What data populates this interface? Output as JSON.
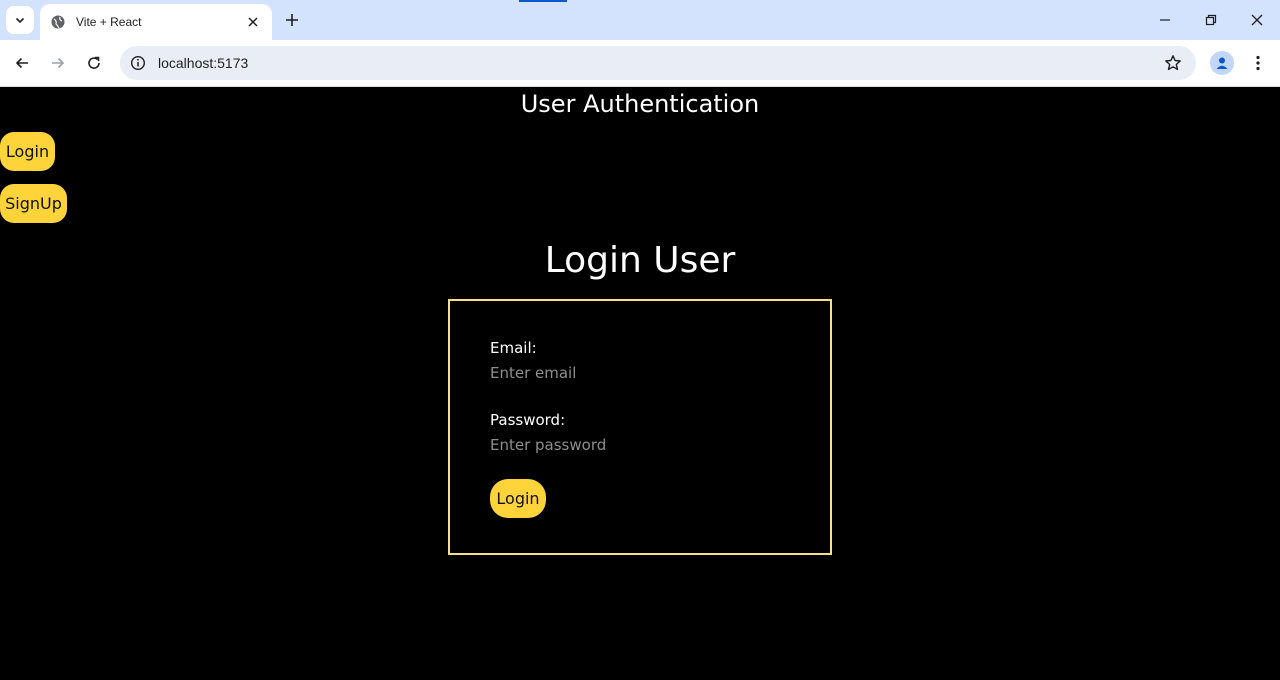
{
  "browser": {
    "tab_title": "Vite + React",
    "url": "localhost:5173"
  },
  "app": {
    "title": "User Authentication",
    "nav": {
      "login_label": "Login",
      "signup_label": "SignUp"
    }
  },
  "form": {
    "title": "Login User",
    "email_label": "Email:",
    "email_placeholder": "Enter email",
    "password_label": "Password:",
    "password_placeholder": "Enter password",
    "submit_label": "Login"
  },
  "colors": {
    "accent": "#ffd43b",
    "form_border": "#f7e08a",
    "background": "#000000"
  }
}
